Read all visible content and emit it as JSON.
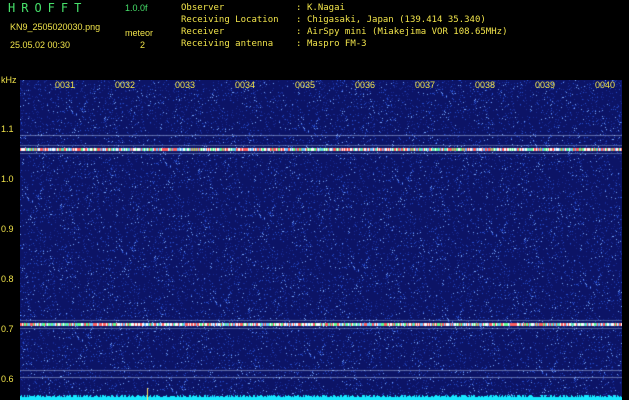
{
  "app": {
    "title": "HROFFT",
    "version": "1.0.0f"
  },
  "file": {
    "name": "KN9_2505020030.png",
    "datetime": "25.05.02 00:30"
  },
  "meteor": {
    "label": "meteor",
    "count": "2"
  },
  "info": [
    {
      "label": "Observer",
      "value": "K.Nagai"
    },
    {
      "label": "Receiving Location",
      "value": "Chigasaki, Japan (139.414 35.340)"
    },
    {
      "label": "Receiver",
      "value": "AirSpy mini (Miakejima VOR 108.65MHz)"
    },
    {
      "label": "Receiving antenna",
      "value": "Maspro FM-3"
    }
  ],
  "axis": {
    "y_unit": "kHz",
    "y_ticks": [
      "1.1",
      "1.0",
      "0.9",
      "0.8",
      "0.7",
      "0.6"
    ],
    "x_ticks": [
      "0031",
      "0032",
      "0033",
      "0034",
      "0035",
      "0036",
      "0037",
      "0038",
      "0039",
      "0040"
    ]
  },
  "colors": {
    "title": "#46e06a",
    "text": "#f0e34a",
    "background": "#0c1466",
    "signal_line": "#c8e8ff",
    "noise_floor": "#17e8ff"
  },
  "spectrogram": {
    "signal_lines_khz": [
      1.06,
      0.71
    ]
  }
}
